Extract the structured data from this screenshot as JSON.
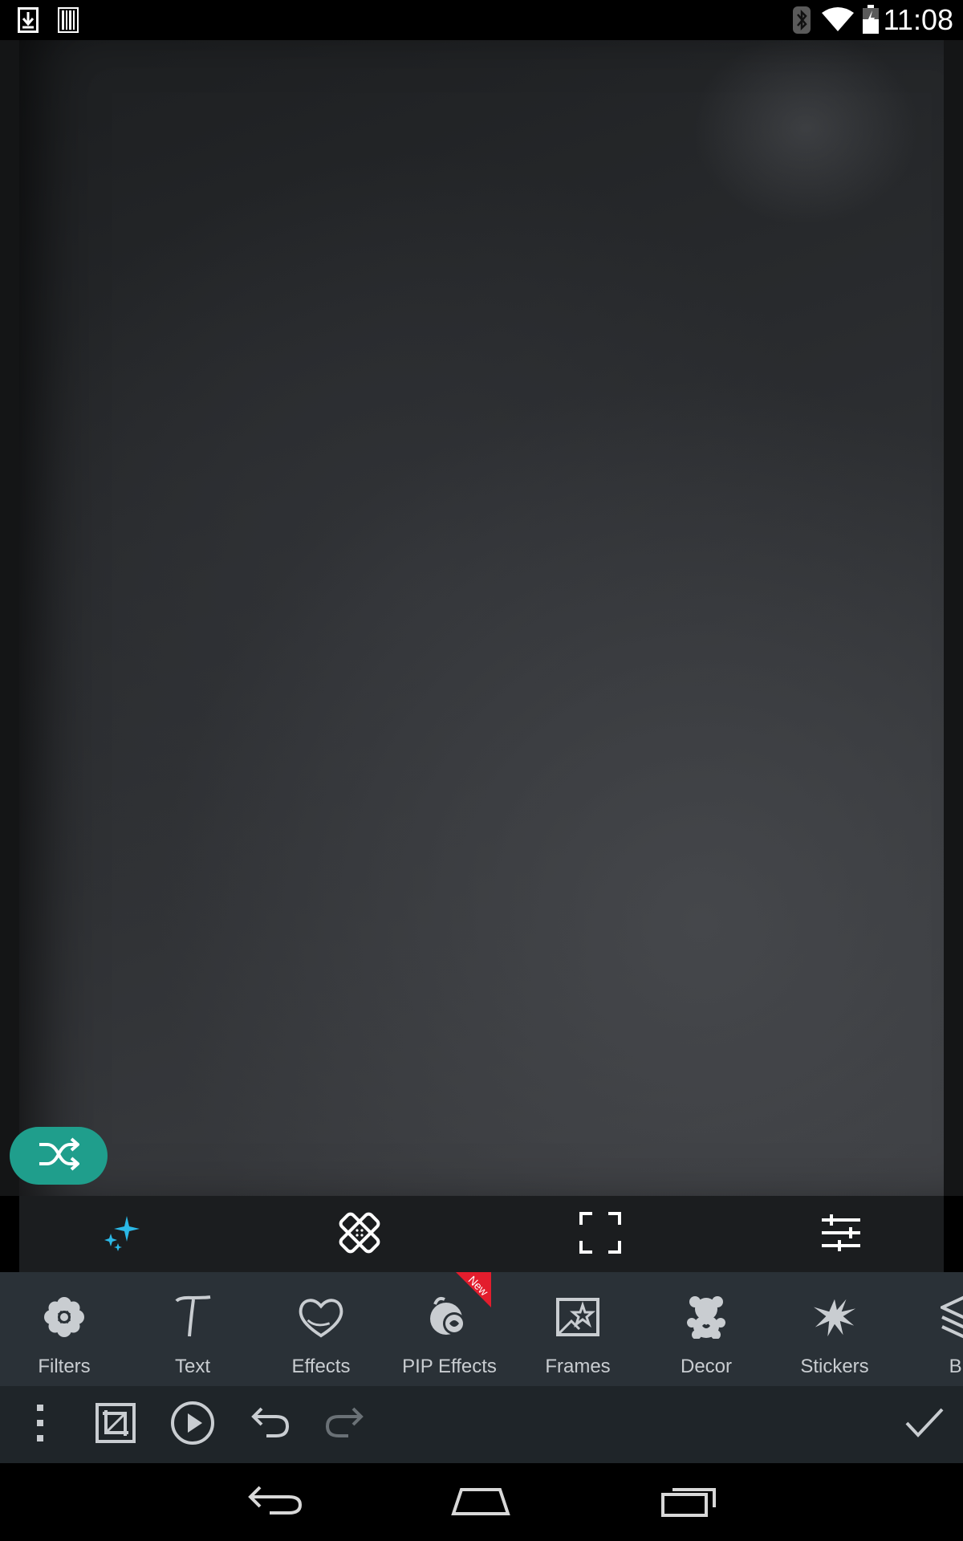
{
  "status_bar": {
    "time": "11:08",
    "left_icons": [
      "download-icon",
      "barcode-icon"
    ],
    "right_icons": [
      "bluetooth-icon",
      "wifi-icon",
      "battery-icon"
    ]
  },
  "canvas": {
    "shuffle_icon": "shuffle-icon"
  },
  "tool_strip": {
    "tools": [
      {
        "icon": "magic-wand-sparkle-icon",
        "accent": "#2bb8e6"
      },
      {
        "icon": "healing-bandage-icon"
      },
      {
        "icon": "fullscreen-icon"
      },
      {
        "icon": "adjust-sliders-icon"
      }
    ]
  },
  "categories": {
    "items": [
      {
        "label": "Filters",
        "icon": "flower-icon"
      },
      {
        "label": "Text",
        "icon": "text-icon"
      },
      {
        "label": "Effects",
        "icon": "heart-icon"
      },
      {
        "label": "PIP Effects",
        "icon": "pip-effects-icon",
        "badge": "New"
      },
      {
        "label": "Frames",
        "icon": "frame-star-icon"
      },
      {
        "label": "Decor",
        "icon": "teddy-bear-icon"
      },
      {
        "label": "Stickers",
        "icon": "splat-icon"
      },
      {
        "label": "Ble",
        "icon": "layers-icon"
      }
    ]
  },
  "action_bar": {
    "buttons": [
      "more-vert-icon",
      "crop-icon",
      "play-icon",
      "undo-icon",
      "redo-icon",
      "apply-check-icon"
    ]
  },
  "nav_bar": {
    "buttons": [
      "back-icon",
      "home-icon",
      "recents-icon"
    ]
  },
  "colors": {
    "accent_teal": "#1f9e8c",
    "badge_red": "#e31d2d",
    "category_bg": "#2a3137"
  }
}
